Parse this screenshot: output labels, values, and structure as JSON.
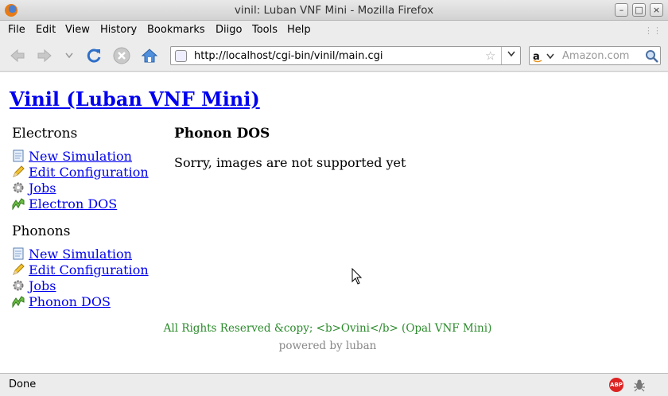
{
  "window": {
    "title": "vinil: Luban VNF Mini - Mozilla Firefox"
  },
  "menu": [
    "File",
    "Edit",
    "View",
    "History",
    "Bookmarks",
    "Diigo",
    "Tools",
    "Help"
  ],
  "toolbar": {
    "url": "http://localhost/cgi-bin/vinil/main.cgi",
    "search_placeholder": "Amazon.com",
    "search_engine_icon": "amazon-icon"
  },
  "page": {
    "site_title": "Vinil (Luban VNF Mini)",
    "sections": [
      {
        "heading": "Electrons",
        "items": [
          {
            "label": "New Simulation",
            "icon": "document-icon"
          },
          {
            "label": "Edit Configuration",
            "icon": "pencil-icon"
          },
          {
            "label": "Jobs",
            "icon": "gear-icon"
          },
          {
            "label": "Electron DOS",
            "icon": "chart-icon"
          }
        ]
      },
      {
        "heading": "Phonons",
        "items": [
          {
            "label": "New Simulation",
            "icon": "document-icon"
          },
          {
            "label": "Edit Configuration",
            "icon": "pencil-icon"
          },
          {
            "label": "Jobs",
            "icon": "gear-icon"
          },
          {
            "label": "Phonon DOS",
            "icon": "chart-icon"
          }
        ]
      }
    ],
    "main_heading": "Phonon DOS",
    "main_message": "Sorry, images are not supported yet",
    "footer_rights": "All Rights Reserved &copy; <b>Ovini</b> (Opal VNF Mini)",
    "footer_powered": "powered by luban"
  },
  "status": {
    "text": "Done"
  },
  "colors": {
    "link": "#0000ee",
    "footer_green": "#2a8a2a",
    "footer_gray": "#888888"
  }
}
